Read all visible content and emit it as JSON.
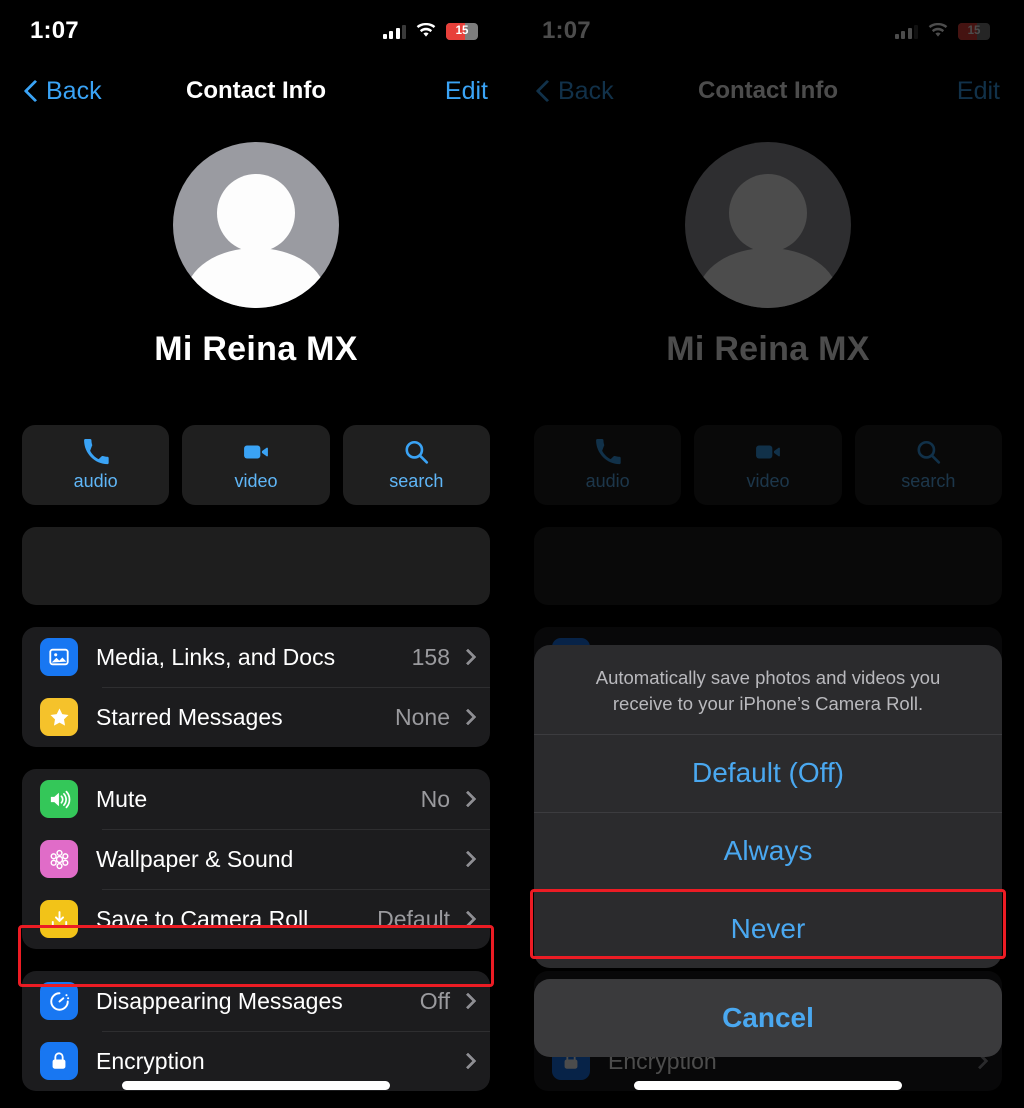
{
  "status_bar": {
    "time": "1:07",
    "battery_level": "15",
    "signal_icon": "cellular-bars-icon",
    "wifi_icon": "wifi-icon",
    "battery_icon": "battery-icon"
  },
  "nav": {
    "back_label": "Back",
    "title": "Contact Info",
    "edit_label": "Edit"
  },
  "profile": {
    "name": "Mi Reina MX",
    "avatar_icon": "person-placeholder-icon"
  },
  "actions": [
    {
      "label": "audio",
      "icon": "phone-icon"
    },
    {
      "label": "video",
      "icon": "video-camera-icon"
    },
    {
      "label": "search",
      "icon": "search-icon"
    }
  ],
  "groups": [
    {
      "name": "media-group",
      "rows": [
        {
          "label": "Media, Links, and Docs",
          "value": "158",
          "icon": "photo-icon",
          "color": "#1877f2"
        },
        {
          "label": "Starred Messages",
          "value": "None",
          "icon": "star-icon",
          "color": "#f5c22b"
        }
      ]
    },
    {
      "name": "settings-group",
      "rows": [
        {
          "label": "Mute",
          "value": "No",
          "icon": "speaker-icon",
          "color": "#34c759"
        },
        {
          "label": "Wallpaper & Sound",
          "value": "",
          "icon": "wallpaper-icon",
          "color": "#e06cc8"
        },
        {
          "label": "Save to Camera Roll",
          "value": "Default",
          "icon": "download-icon",
          "color": "#f2c318"
        }
      ]
    },
    {
      "name": "privacy-group",
      "rows": [
        {
          "label": "Disappearing Messages",
          "value": "Off",
          "icon": "timer-icon",
          "color": "#1877f2"
        },
        {
          "label": "Encryption",
          "value": "",
          "icon": "lock-icon",
          "color": "#1877f2"
        }
      ]
    }
  ],
  "action_sheet": {
    "title": "Automatically save photos and videos you receive to your iPhone’s Camera Roll.",
    "options": [
      "Default (Off)",
      "Always",
      "Never"
    ],
    "cancel_label": "Cancel",
    "highlighted_option": "Never"
  },
  "annotations": {
    "highlight_color": "#ec1c24",
    "left_highlight_target": "Save to Camera Roll",
    "right_highlight_target": "Never"
  }
}
